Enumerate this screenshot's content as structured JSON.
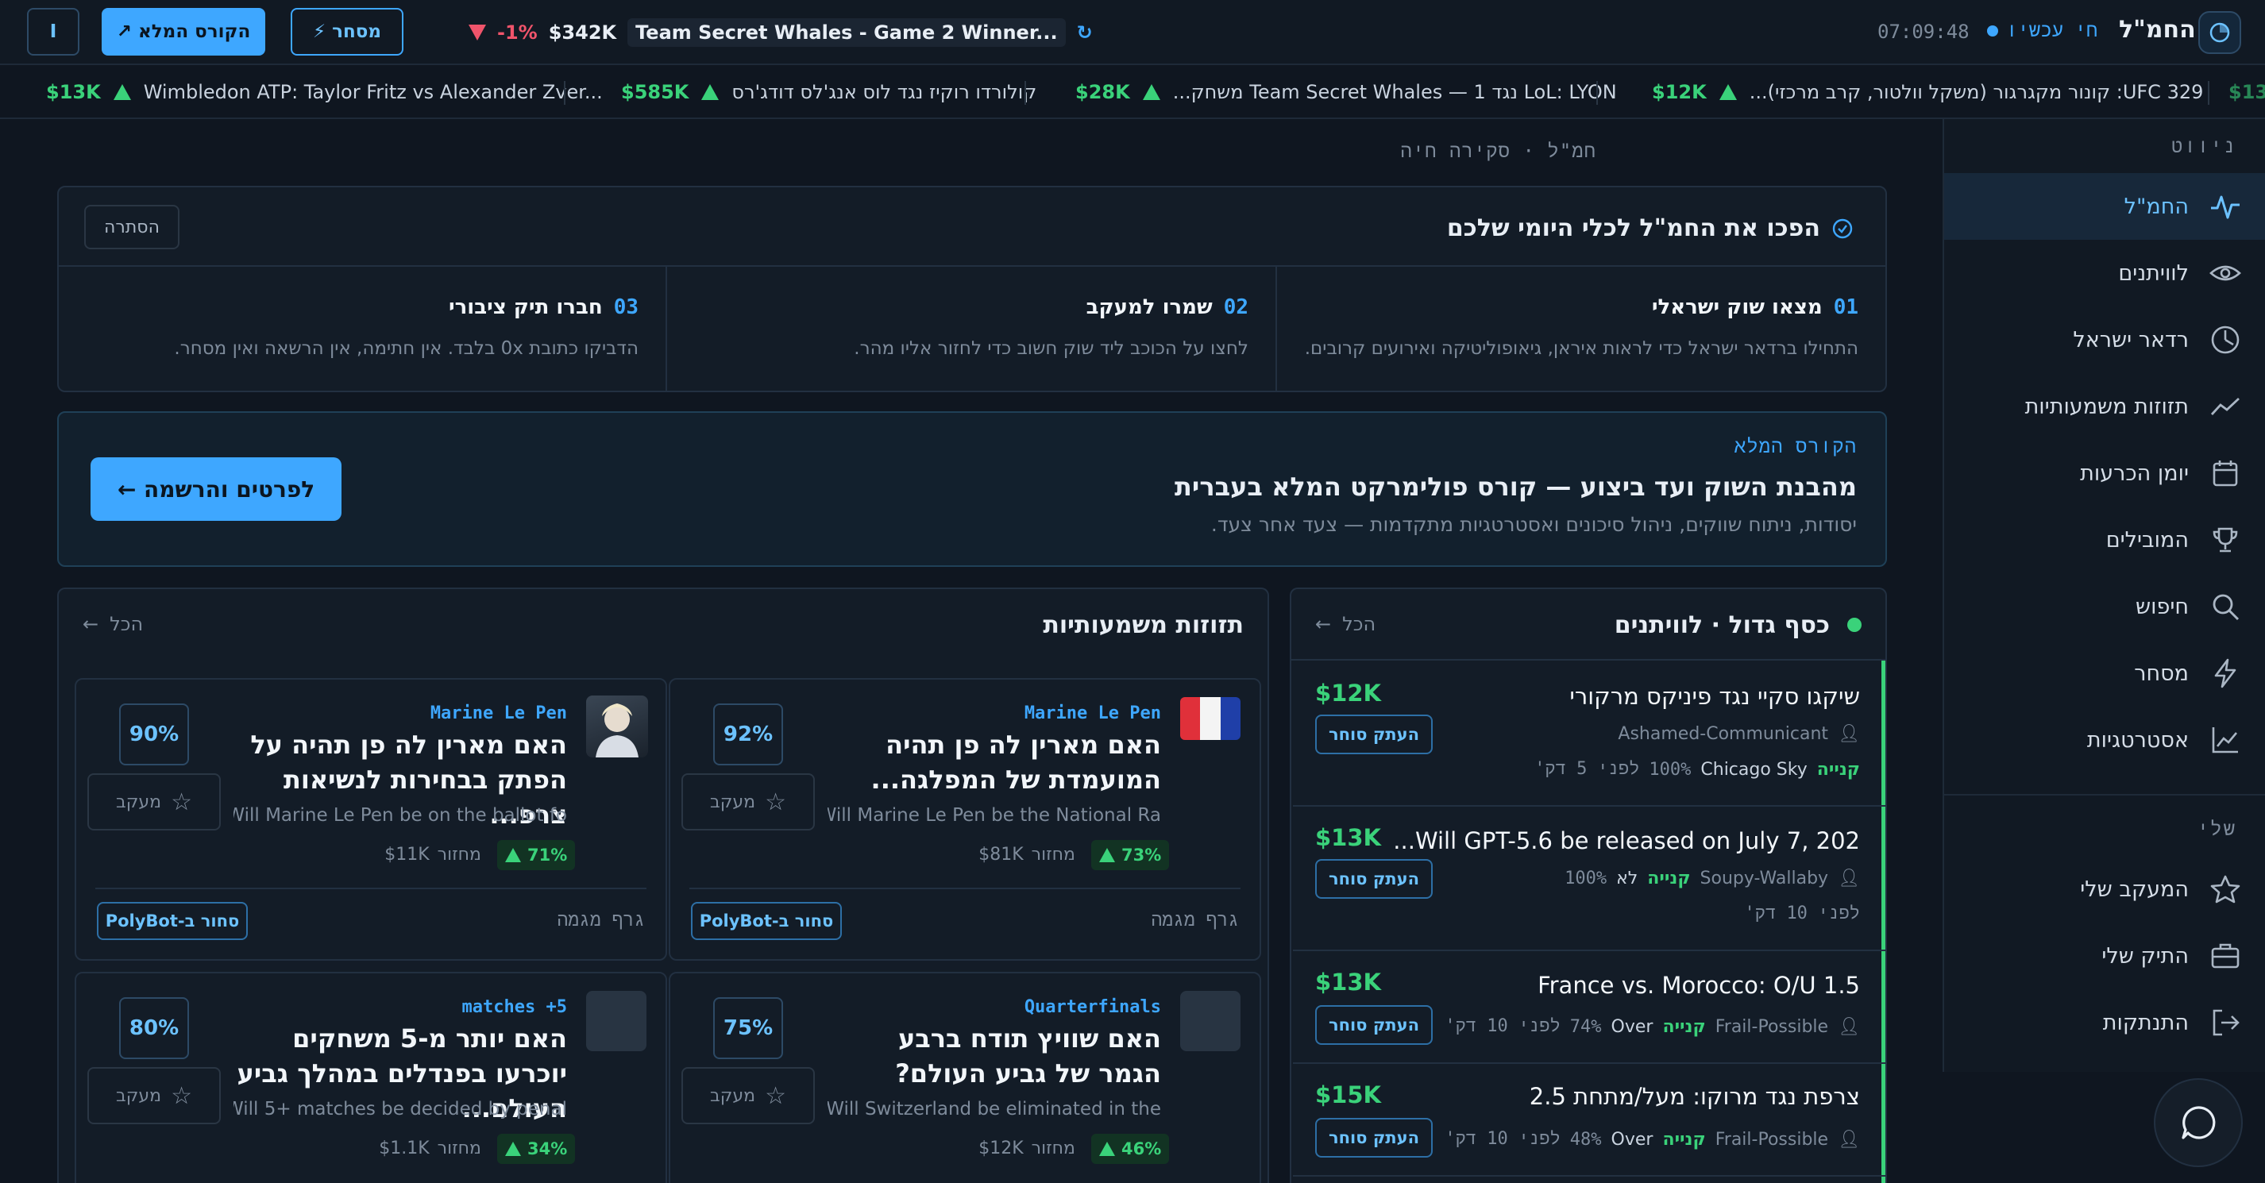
{
  "topbar": {
    "brand": "החמ\"ל",
    "live_label": "חי עכשיו",
    "clock": "07:09:48",
    "ticker_highlight": "Team Secret Whales - Game 2 Winner...",
    "highlight_amount": "$342K",
    "highlight_change": "-1%",
    "trade_button": "מסחר",
    "course_button": "הקורס המלא",
    "avatar_letter": "I"
  },
  "ticker": [
    {
      "amount": "$13K",
      "name": "Wimbledon ATP: Taylor Fritz vs Alexander Zver..."
    },
    {
      "amount": "$585K",
      "name": "קולורדו רוקיז נגד לוס אנג'לס דודג'רס"
    },
    {
      "amount": "$28K",
      "name": "LoL: LYON נגד Team Secret Whales — 1 משחק..."
    },
    {
      "amount": "$12K",
      "name": "UFC 329: קונור מקגרגור (משקל וולטור, קרב מרכזי)..."
    },
    {
      "amount": "$13"
    }
  ],
  "sidebar": {
    "nav_heading": "ניווט",
    "items": [
      {
        "label": "החמ\"ל",
        "icon": "pulse-icon"
      },
      {
        "label": "לוויתנים",
        "icon": "eye-icon"
      },
      {
        "label": "רדאר ישראל",
        "icon": "radar-icon"
      },
      {
        "label": "תזוזות משמעותיות",
        "icon": "trend-icon"
      },
      {
        "label": "יומן הכרעות",
        "icon": "calendar-icon"
      },
      {
        "label": "המובילים",
        "icon": "trophy-icon"
      },
      {
        "label": "חיפוש",
        "icon": "search-icon"
      },
      {
        "label": "מסחר",
        "icon": "bolt-icon"
      },
      {
        "label": "אסטרטגיות",
        "icon": "chart-icon"
      }
    ],
    "mine_heading": "שלי",
    "mine_items": [
      {
        "label": "המעקב שלי",
        "icon": "star-icon"
      },
      {
        "label": "התיק שלי",
        "icon": "briefcase-icon"
      },
      {
        "label": "התנתקות",
        "icon": "logout-icon"
      }
    ]
  },
  "breadcrumb": "חמ\"ל · סקירה חיה",
  "onboarding": {
    "title": "הפכו את החמ\"ל לכלי היומי שלכם",
    "hide_button": "הסתרה",
    "steps": [
      {
        "num": "01",
        "title": "מצאו שוק ישראלי",
        "desc": "התחילו ברדאר ישראל כדי לראות איראן, גיאופוליטיקה ואירועים קרובים."
      },
      {
        "num": "02",
        "title": "שמרו למעקב",
        "desc": "לחצו על הכוכב ליד שוק חשוב כדי לחזור אליו מהר."
      },
      {
        "num": "03",
        "title": "חברו תיק ציבורי",
        "desc": "הדביקו כתובת 0x בלבד. אין חתימה, אין הרשאה ואין מסחר."
      }
    ]
  },
  "course": {
    "eyebrow": "הקורס המלא",
    "title": "מהבנת השוק ועד ביצוע — קורס פולימרקט המלא בעברית",
    "desc": "יסודות, ניתוח שווקים, ניהול סיכונים ואסטרטגיות מתקדמות — צעד אחר צעד.",
    "cta": "לפרטים והרשמה ←"
  },
  "whales": {
    "title": "כסף גדול · לוויתנים",
    "all_link": "הכל",
    "copy_label": "העתק סוחר",
    "rows": [
      {
        "title": "שיקגו סקיי נגד פיניקס מרקורי",
        "amount": "$12K",
        "trader": "Ashamed-Communicant",
        "side": "קנייה",
        "outcome": "Chicago Sky",
        "price": "100%",
        "time": "לפני 5 דק'"
      },
      {
        "title": "Will GPT-5.6 be released on July 7, 202...",
        "amount": "$13K",
        "trader": "Soupy-Wallaby",
        "side": "קנייה",
        "outcome": "לא",
        "price": "100%",
        "time": "לפני 10 דק'"
      },
      {
        "title": "France vs. Morocco: O/U 1.5",
        "amount": "$13K",
        "trader": "Frail-Possible",
        "side": "קנייה",
        "outcome": "Over",
        "price": "74%",
        "time": "לפני 10 דק'"
      },
      {
        "title": "צרפת נגד מרוקו: מעל/מתחת 2.5",
        "amount": "$15K",
        "trader": "Frail-Possible",
        "side": "קנייה",
        "outcome": "Over",
        "price": "48%",
        "time": "לפני 10 דק'"
      }
    ]
  },
  "moves": {
    "title": "תזוזות משמעותיות",
    "all_link": "הכל",
    "track_label": "מעקב",
    "trend_label": "גרף מגמה",
    "polybot_label": "סחור ב-PolyBot",
    "volume_label": "מחזור",
    "cards": [
      {
        "category": "Marine Le Pen",
        "title": "האם מארין לה פן תהיה המועמדת של המפלגה...",
        "subtitle": "Will Marine Le Pen be the National Ra...",
        "pct": "92%",
        "change": "73%",
        "volume": "$81K",
        "image": "flag"
      },
      {
        "category": "Marine Le Pen",
        "title": "האם מארין לה פן תהיה על הפתק בבחירות לנשיאות צרפ...",
        "subtitle": "Will Marine Le Pen be on the ballot fo...",
        "pct": "90%",
        "change": "71%",
        "volume": "$11K",
        "image": "portrait"
      },
      {
        "category": "Quarterfinals",
        "title": "האם שוויץ תודח ברבע הגמר של גביע העולם?",
        "subtitle": "Will Switzerland be eliminated in the ...",
        "pct": "75%",
        "change": "46%",
        "volume": "$12K",
        "image": "blank"
      },
      {
        "category": "5+ matches",
        "title": "האם יותר מ-5 משחקים יוכרעו בפנדלים במהלך גביע העולם...",
        "subtitle": "Will 5+ matches be decided by penal...",
        "pct": "80%",
        "change": "34%",
        "volume": "$1.1K",
        "image": "blank"
      }
    ]
  },
  "colors": {
    "accent": "#3ea7ff",
    "up": "#3ad27a",
    "down": "#f0546b",
    "bg": "#0f1620"
  }
}
